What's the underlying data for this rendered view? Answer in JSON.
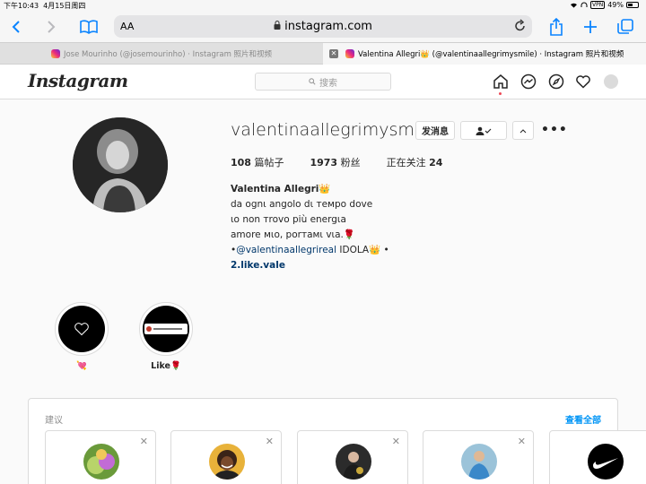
{
  "status_bar": {
    "time": "下午10:43",
    "date": "4月15日周四",
    "vpn": "VPN",
    "battery": "49%"
  },
  "browser": {
    "aa_label": "AA",
    "url": "instagram.com",
    "tabs": [
      {
        "title": "Jose Mourinho (@josemourinho) · Instagram 照片和视频",
        "active": false
      },
      {
        "title": "Valentina Allegri👑 (@valentinaallegrimysmile) · Instagram 照片和视频",
        "active": true
      }
    ]
  },
  "instagram": {
    "logo": "Instagram",
    "search_placeholder": "搜索"
  },
  "profile": {
    "username": "valentinaallegrimysmile",
    "message_button": "发消息",
    "stats": {
      "posts_count": "108",
      "posts_label": "篇帖子",
      "followers_count": "1973",
      "followers_label": "粉丝",
      "following_label": "正在关注",
      "following_count": "24"
    },
    "bio": {
      "name": "Valentina Allegri👑",
      "line1": "da ognι angolo dι тeмpo dove",
      "line2": "ιo non тrovo più energιa",
      "line3": "amore мιo, porтaмι vιa.🌹",
      "line4_prefix": "•",
      "line4_link": "@valentinaallegrireal",
      "line4_suffix": " IDOLA👑 •",
      "website": "2.like.vale"
    }
  },
  "highlights": [
    {
      "label": "💘"
    },
    {
      "label": "Like🌹"
    }
  ],
  "suggestions": {
    "title": "建议",
    "see_all": "查看全部"
  },
  "colors": {
    "accent_blue": "#0095f6",
    "link_dark": "#00376b",
    "safari_blue": "#0a84ff"
  }
}
